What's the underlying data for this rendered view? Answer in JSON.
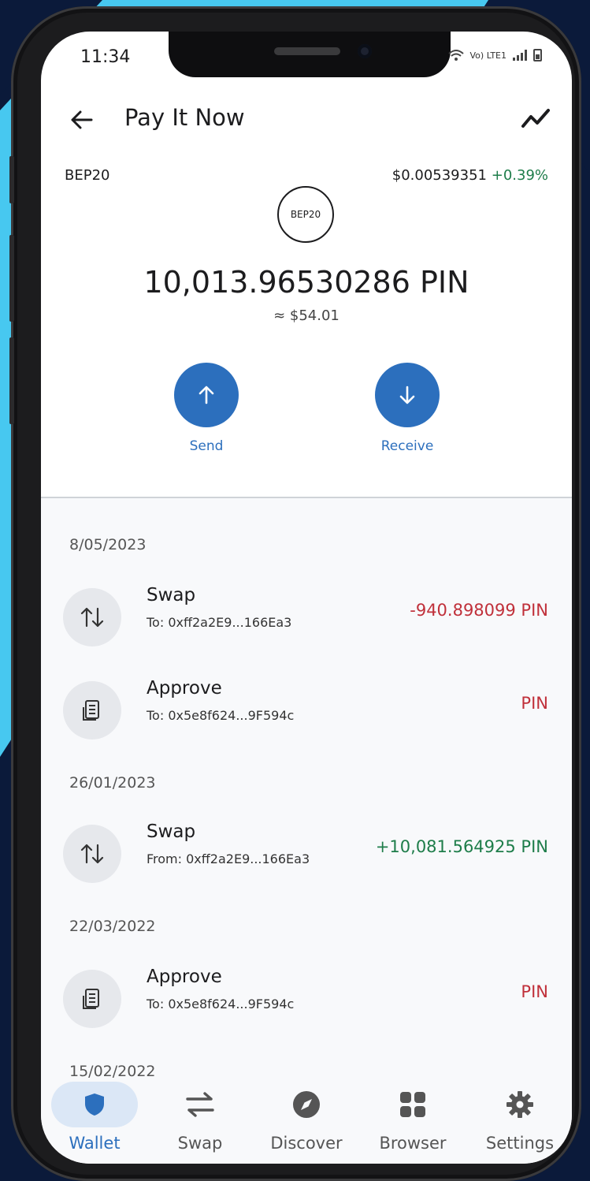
{
  "status_bar": {
    "time": "11:34",
    "network": "Vo) LTE1"
  },
  "header": {
    "title": "Pay It Now"
  },
  "token": {
    "standard": "BEP20",
    "price": "$0.00539351",
    "price_change": "+0.39%",
    "logo_text": "BEP20",
    "balance": "10,013.96530286 PIN",
    "fiat_value": "≈ $54.01"
  },
  "actions": {
    "send_label": "Send",
    "receive_label": "Receive"
  },
  "transactions": [
    {
      "date": "8/05/2023",
      "items": [
        {
          "type": "Swap",
          "address": "To: 0xff2a2E9...166Ea3",
          "amount": "-940.898099 PIN"
        },
        {
          "type": "Approve",
          "address": "To: 0x5e8f624...9F594c",
          "amount": "PIN"
        }
      ]
    },
    {
      "date": "26/01/2023",
      "items": [
        {
          "type": "Swap",
          "address": "From: 0xff2a2E9...166Ea3",
          "amount": "+10,081.564925 PIN"
        }
      ]
    },
    {
      "date": "22/03/2022",
      "items": [
        {
          "type": "Approve",
          "address": "To: 0x5e8f624...9F594c",
          "amount": "PIN"
        }
      ]
    },
    {
      "date": "15/02/2022",
      "items": []
    }
  ],
  "nav": {
    "items": [
      {
        "label": "Wallet",
        "icon": "shield-icon",
        "active": true
      },
      {
        "label": "Swap",
        "icon": "swap-icon",
        "active": false
      },
      {
        "label": "Discover",
        "icon": "compass-icon",
        "active": false
      },
      {
        "label": "Browser",
        "icon": "grid-icon",
        "active": false
      },
      {
        "label": "Settings",
        "icon": "gear-icon",
        "active": false
      }
    ]
  },
  "colors": {
    "accent": "#2c6fbd",
    "negative": "#c0303a",
    "positive": "#1e7d4a",
    "background_shape": "#47c8f0"
  }
}
